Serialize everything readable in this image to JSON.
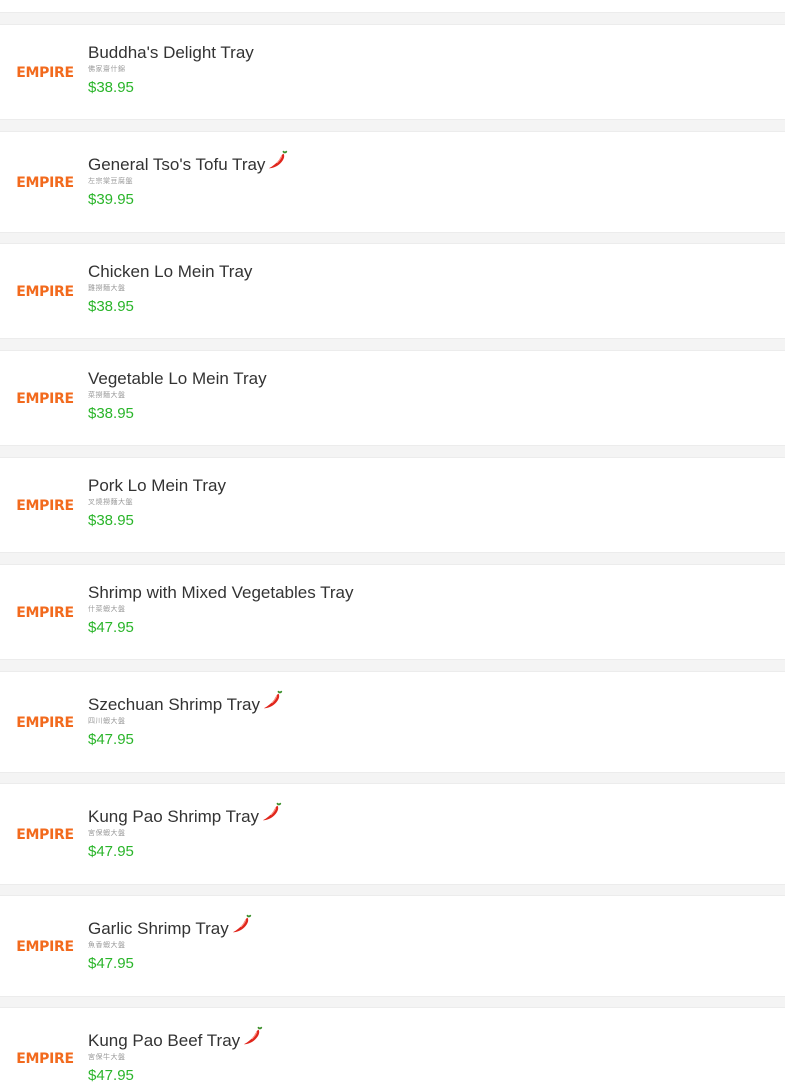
{
  "brand": {
    "logo_text": "EMPIRE",
    "logo_color": "#f26a1d"
  },
  "colors": {
    "price": "#2ab52a",
    "name": "#333333",
    "spicy": "#e0261c"
  },
  "items": [
    {
      "name": "Buddha's Delight Tray",
      "subtitle": "佛家齋什錦",
      "price": "$38.95",
      "spicy": false
    },
    {
      "name": "General Tso's Tofu Tray",
      "subtitle": "左宗棠豆腐盤",
      "price": "$39.95",
      "spicy": true
    },
    {
      "name": "Chicken Lo Mein Tray",
      "subtitle": "雞撈麵大盤",
      "price": "$38.95",
      "spicy": false
    },
    {
      "name": "Vegetable Lo Mein Tray",
      "subtitle": "菜撈麵大盤",
      "price": "$38.95",
      "spicy": false
    },
    {
      "name": "Pork Lo Mein Tray",
      "subtitle": "叉燒撈麵大盤",
      "price": "$38.95",
      "spicy": false
    },
    {
      "name": "Shrimp with Mixed Vegetables Tray",
      "subtitle": "什菜蝦大盤",
      "price": "$47.95",
      "spicy": false
    },
    {
      "name": "Szechuan Shrimp Tray",
      "subtitle": "四川蝦大盤",
      "price": "$47.95",
      "spicy": true
    },
    {
      "name": "Kung Pao Shrimp Tray",
      "subtitle": "宮保蝦大盤",
      "price": "$47.95",
      "spicy": true
    },
    {
      "name": "Garlic Shrimp Tray",
      "subtitle": "魚香蝦大盤",
      "price": "$47.95",
      "spicy": true
    },
    {
      "name": "Kung Pao Beef Tray",
      "subtitle": "宮保牛大盤",
      "price": "$47.95",
      "spicy": true
    }
  ]
}
